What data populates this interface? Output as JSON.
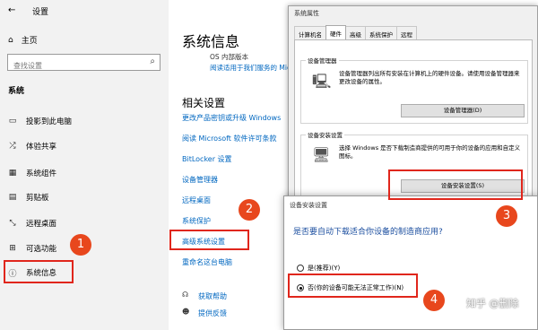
{
  "sidebar": {
    "title": "设置",
    "home_label": "主页",
    "search_placeholder": "查找设置",
    "section_label": "系统",
    "items": [
      {
        "label": "投影到此电脑"
      },
      {
        "label": "体验共享"
      },
      {
        "label": "系统组件"
      },
      {
        "label": "剪贴板"
      },
      {
        "label": "远程桌面"
      },
      {
        "label": "可选功能"
      },
      {
        "label": "系统信息"
      }
    ]
  },
  "main": {
    "page_title": "系统信息",
    "os_version_partial": "OS 内部版本",
    "license_link": "阅读适用于我们服务的 Microsoft 服务协议",
    "related_title": "相关设置",
    "related_links": [
      "更改产品密钥或升级 Windows",
      "阅读 Microsoft 软件许可条款",
      "BitLocker 设置",
      "设备管理器",
      "远程桌面",
      "系统保护",
      "高级系统设置",
      "重命名这台电脑"
    ],
    "help_label": "获取帮助",
    "feedback_label": "提供反馈"
  },
  "system_properties": {
    "title": "系统属性",
    "tabs": [
      "计算机名",
      "硬件",
      "高级",
      "系统保护",
      "远程"
    ],
    "device_manager": {
      "label": "设备管理器",
      "description": "设备管理器列出所有安装在计算机上的硬件设备。请使用设备管理器来更改设备的属性。",
      "button": "设备管理器(D)"
    },
    "device_install": {
      "label": "设备安装设置",
      "description": "选择 Windows 是否下载制造商提供的可用于你的设备的应用和自定义图标。",
      "button": "设备安装设置(S)"
    }
  },
  "device_install_dialog": {
    "title": "设备安装设置",
    "question": "是否要自动下载适合你设备的制造商应用?",
    "options": [
      {
        "label": "是(推荐)(Y)",
        "selected": false
      },
      {
        "label": "否(你的设备可能无法正常工作)(N)",
        "selected": true
      }
    ]
  },
  "annotations": {
    "steps": [
      "1",
      "2",
      "3",
      "4"
    ],
    "watermark": "知乎 @删除",
    "highlight_color": "#e0261c"
  },
  "colors": {
    "link": "#0067c0",
    "sidebar_bg": "#f2f2f2",
    "dialog_bg": "#f0f0f0"
  }
}
